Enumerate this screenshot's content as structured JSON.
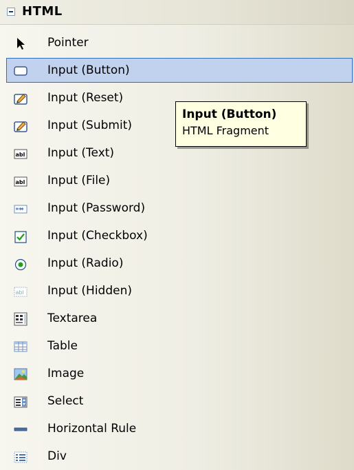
{
  "group": {
    "title": "HTML"
  },
  "items": [
    {
      "label": "Pointer",
      "icon": "pointer-icon"
    },
    {
      "label": "Input (Button)",
      "icon": "button-icon"
    },
    {
      "label": "Input (Reset)",
      "icon": "reset-icon"
    },
    {
      "label": "Input (Submit)",
      "icon": "submit-icon"
    },
    {
      "label": "Input (Text)",
      "icon": "textbox-icon"
    },
    {
      "label": "Input (File)",
      "icon": "file-icon"
    },
    {
      "label": "Input (Password)",
      "icon": "password-icon"
    },
    {
      "label": "Input (Checkbox)",
      "icon": "checkbox-icon"
    },
    {
      "label": "Input (Radio)",
      "icon": "radio-icon"
    },
    {
      "label": "Input (Hidden)",
      "icon": "hidden-icon"
    },
    {
      "label": "Textarea",
      "icon": "textarea-icon"
    },
    {
      "label": "Table",
      "icon": "table-icon"
    },
    {
      "label": "Image",
      "icon": "image-icon"
    },
    {
      "label": "Select",
      "icon": "select-icon"
    },
    {
      "label": "Horizontal Rule",
      "icon": "horizontal-rule-icon"
    },
    {
      "label": "Div",
      "icon": "div-icon"
    }
  ],
  "tooltip": {
    "title": "Input (Button)",
    "subtitle": "HTML Fragment"
  },
  "colors": {
    "selection_bg": "#c1d2ee",
    "selection_border": "#316ac5",
    "tooltip_bg": "#ffffe1"
  }
}
